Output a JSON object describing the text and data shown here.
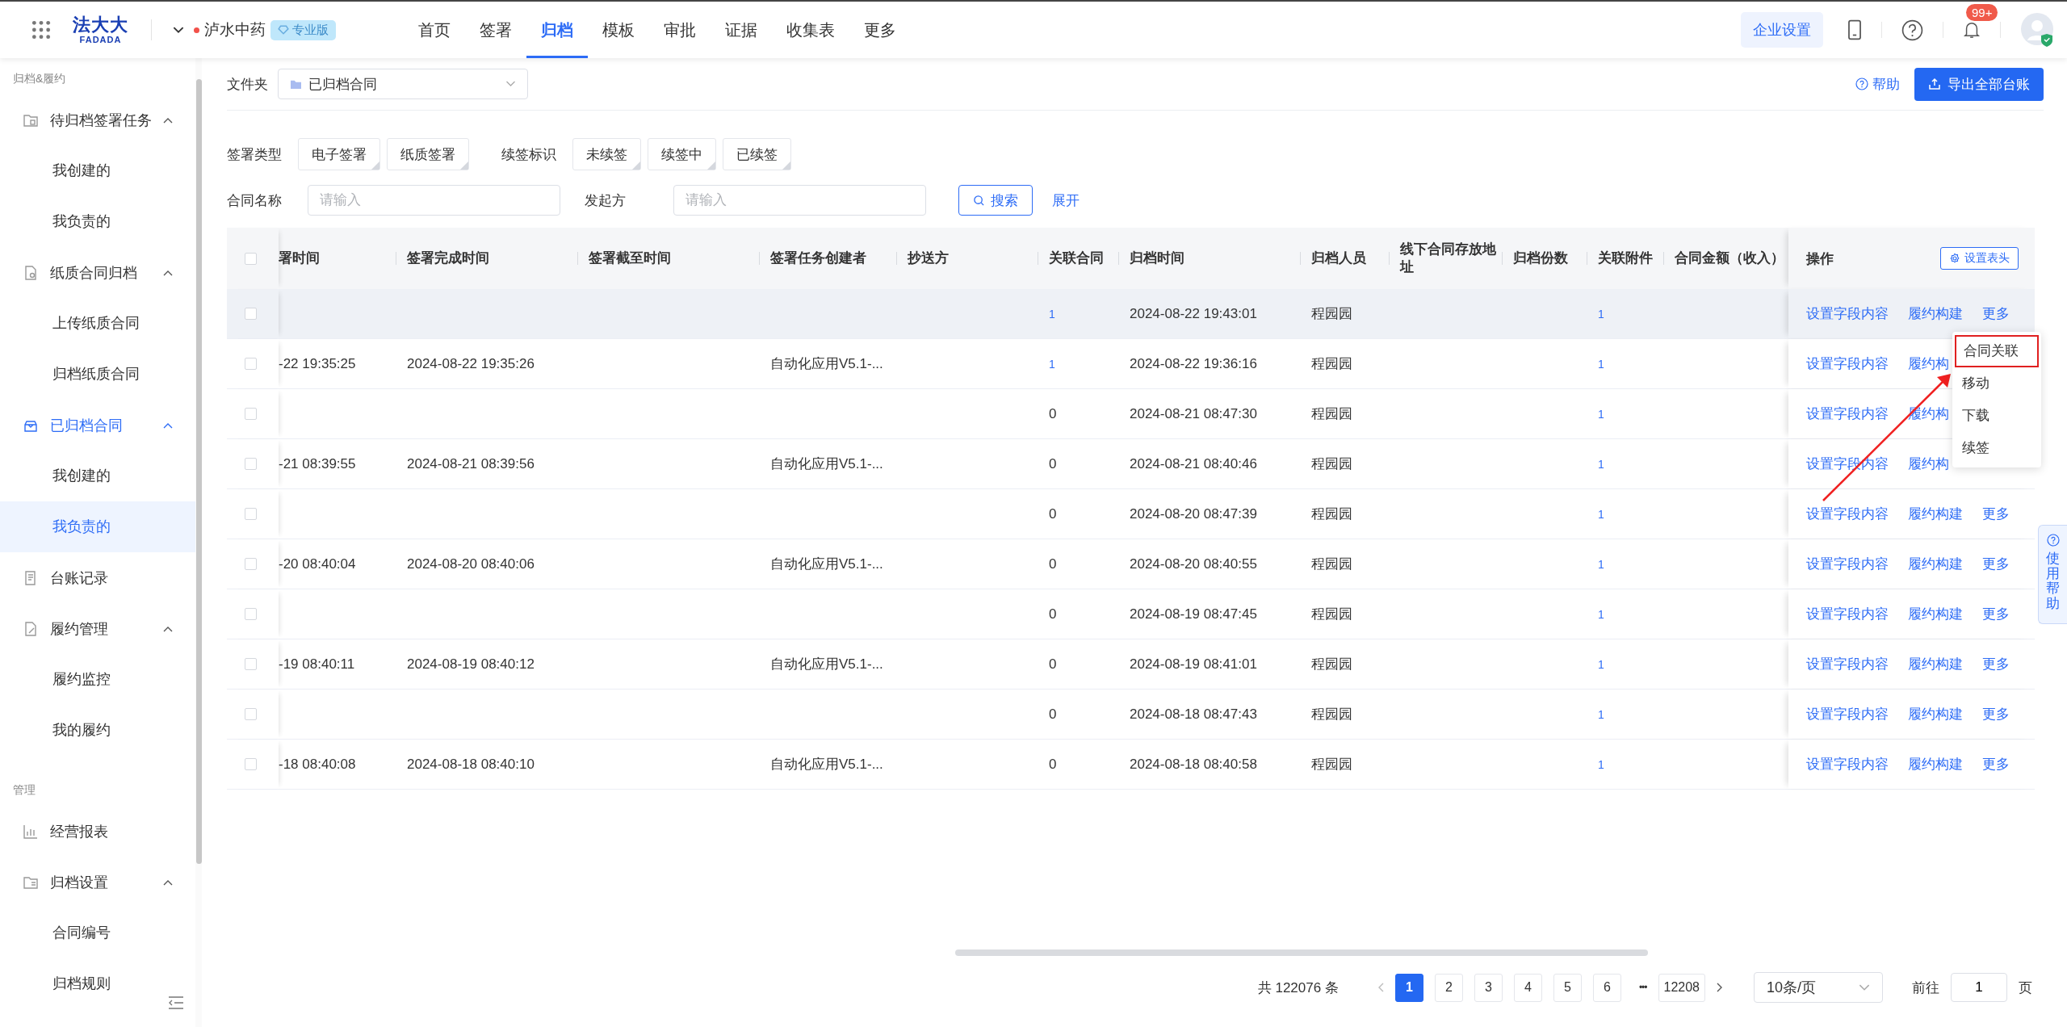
{
  "top_bar": {
    "logo": {
      "name": "法大大",
      "latin": "FADADA"
    },
    "org": {
      "name": "泸水中药",
      "edition": "专业版"
    },
    "nav": [
      {
        "label": "首页",
        "selected": false
      },
      {
        "label": "签署",
        "selected": false
      },
      {
        "label": "归档",
        "selected": true
      },
      {
        "label": "模板",
        "selected": false
      },
      {
        "label": "审批",
        "selected": false
      },
      {
        "label": "证据",
        "selected": false
      },
      {
        "label": "收集表",
        "selected": false
      },
      {
        "label": "更多",
        "selected": false
      }
    ],
    "settings_button": "企业设置",
    "notification_badge": "99+"
  },
  "sidebar": {
    "sections": [
      {
        "title": "归档&履约",
        "items": [
          {
            "label": "待归档签署任务",
            "expanded": true,
            "children": [
              {
                "label": "我创建的",
                "selected": false
              },
              {
                "label": "我负责的",
                "selected": false
              }
            ]
          },
          {
            "label": "纸质合同归档",
            "expanded": true,
            "children": [
              {
                "label": "上传纸质合同",
                "selected": false
              },
              {
                "label": "归档纸质合同",
                "selected": false
              }
            ]
          },
          {
            "label": "已归档合同",
            "expanded": true,
            "children": [
              {
                "label": "我创建的",
                "selected": false
              },
              {
                "label": "我负责的",
                "selected": true
              }
            ]
          },
          {
            "label": "台账记录",
            "selected": false
          },
          {
            "label": "履约管理",
            "expanded": true,
            "children": [
              {
                "label": "履约监控",
                "selected": false
              },
              {
                "label": "我的履约",
                "selected": false
              }
            ]
          }
        ]
      },
      {
        "title": "管理",
        "items": [
          {
            "label": "经营报表",
            "selected": false
          },
          {
            "label": "归档设置",
            "expanded": true,
            "children": [
              {
                "label": "合同编号",
                "selected": false
              },
              {
                "label": "归档规则",
                "selected": false
              }
            ]
          }
        ]
      }
    ]
  },
  "folder_filter": {
    "label": "文件夹",
    "value": "已归档合同"
  },
  "help_link": "帮助",
  "export_button": "导出全部台账",
  "tag_filters": [
    {
      "label": "签署类型",
      "options": [
        {
          "label": "电子签署",
          "selected": false
        },
        {
          "label": "纸质签署",
          "selected": false
        }
      ]
    },
    {
      "label": "续签标识",
      "options": [
        {
          "label": "未续签",
          "selected": false
        },
        {
          "label": "续签中",
          "selected": false
        },
        {
          "label": "已续签",
          "selected": false
        }
      ]
    }
  ],
  "search_fields": [
    {
      "label": "合同名称",
      "placeholder": "请输入"
    },
    {
      "label": "发起方",
      "placeholder": "请输入"
    }
  ],
  "search_button": "搜索",
  "expand_link": "展开",
  "table": {
    "all_checked": false,
    "columns": [
      "署时间",
      "签署完成时间",
      "签署截至时间",
      "签署任务创建者",
      "抄送方",
      "关联合同",
      "归档时间",
      "归档人员",
      "线下合同存放地址",
      "归档份数",
      "关联附件",
      "合同金额（收入）"
    ],
    "actions_header": "操作",
    "column_settings_button": "设置表头",
    "rows": [
      {
        "checked": false,
        "hovered": true,
        "cells": [
          null,
          null,
          null,
          null,
          null,
          {
            "text": "1",
            "link": true
          },
          "2024-08-22 19:43:01",
          "程园园",
          null,
          null,
          {
            "text": "1",
            "link": true
          },
          null
        ],
        "actions": [
          "设置字段内容",
          "履约构建",
          "更多"
        ],
        "menu": [
          {
            "label": "合同关联",
            "highlighted": true
          },
          {
            "label": "移动",
            "highlighted": false
          },
          {
            "label": "下载",
            "highlighted": false
          },
          {
            "label": "续签",
            "highlighted": false
          }
        ]
      },
      {
        "checked": false,
        "hovered": false,
        "cells": [
          "-22 19:35:25",
          "2024-08-22 19:35:26",
          null,
          "自动化应用V5.1-...",
          null,
          {
            "text": "1",
            "link": true
          },
          "2024-08-22 19:36:16",
          "程园园",
          null,
          null,
          {
            "text": "1",
            "link": true
          },
          null
        ],
        "actions": [
          "设置字段内容",
          "履约构"
        ]
      },
      {
        "checked": false,
        "hovered": false,
        "cells": [
          null,
          null,
          null,
          null,
          null,
          "0",
          "2024-08-21 08:47:30",
          "程园园",
          null,
          null,
          {
            "text": "1",
            "link": true
          },
          null
        ],
        "actions": [
          "设置字段内容",
          "履约构"
        ]
      },
      {
        "checked": false,
        "hovered": false,
        "cells": [
          "-21 08:39:55",
          "2024-08-21 08:39:56",
          null,
          "自动化应用V5.1-...",
          null,
          "0",
          "2024-08-21 08:40:46",
          "程园园",
          null,
          null,
          {
            "text": "1",
            "link": true
          },
          null
        ],
        "actions": [
          "设置字段内容",
          "履约构"
        ]
      },
      {
        "checked": false,
        "hovered": false,
        "cells": [
          null,
          null,
          null,
          null,
          null,
          "0",
          "2024-08-20 08:47:39",
          "程园园",
          null,
          null,
          {
            "text": "1",
            "link": true
          },
          null
        ],
        "actions": [
          "设置字段内容",
          "履约构建",
          "更多"
        ]
      },
      {
        "checked": false,
        "hovered": false,
        "cells": [
          "-20 08:40:04",
          "2024-08-20 08:40:06",
          null,
          "自动化应用V5.1-...",
          null,
          "0",
          "2024-08-20 08:40:55",
          "程园园",
          null,
          null,
          {
            "text": "1",
            "link": true
          },
          null
        ],
        "actions": [
          "设置字段内容",
          "履约构建",
          "更多"
        ]
      },
      {
        "checked": false,
        "hovered": false,
        "cells": [
          null,
          null,
          null,
          null,
          null,
          "0",
          "2024-08-19 08:47:45",
          "程园园",
          null,
          null,
          {
            "text": "1",
            "link": true
          },
          null
        ],
        "actions": [
          "设置字段内容",
          "履约构建",
          "更多"
        ]
      },
      {
        "checked": false,
        "hovered": false,
        "cells": [
          "-19 08:40:11",
          "2024-08-19 08:40:12",
          null,
          "自动化应用V5.1-...",
          null,
          "0",
          "2024-08-19 08:41:01",
          "程园园",
          null,
          null,
          {
            "text": "1",
            "link": true
          },
          null
        ],
        "actions": [
          "设置字段内容",
          "履约构建",
          "更多"
        ]
      },
      {
        "checked": false,
        "hovered": false,
        "cells": [
          null,
          null,
          null,
          null,
          null,
          "0",
          "2024-08-18 08:47:43",
          "程园园",
          null,
          null,
          {
            "text": "1",
            "link": true
          },
          null
        ],
        "actions": [
          "设置字段内容",
          "履约构建",
          "更多"
        ]
      },
      {
        "checked": false,
        "hovered": false,
        "cells": [
          "-18 08:40:08",
          "2024-08-18 08:40:10",
          null,
          "自动化应用V5.1-...",
          null,
          "0",
          "2024-08-18 08:40:58",
          "程园园",
          null,
          null,
          {
            "text": "1",
            "link": true
          },
          null
        ],
        "actions": [
          "设置字段内容",
          "履约构建",
          "更多"
        ]
      }
    ]
  },
  "pagination": {
    "total": "共 122076 条",
    "pages": [
      {
        "label": "1",
        "selected": true
      },
      {
        "label": "2",
        "selected": false
      },
      {
        "label": "3",
        "selected": false
      },
      {
        "label": "4",
        "selected": false
      },
      {
        "label": "5",
        "selected": false
      },
      {
        "label": "6",
        "selected": false
      }
    ],
    "ellipsis": "•••",
    "last_page": "12208",
    "page_size": "10条/页",
    "goto_label": "前往",
    "goto_value": "1",
    "page_unit": "页"
  },
  "side_help": "使用帮助"
}
